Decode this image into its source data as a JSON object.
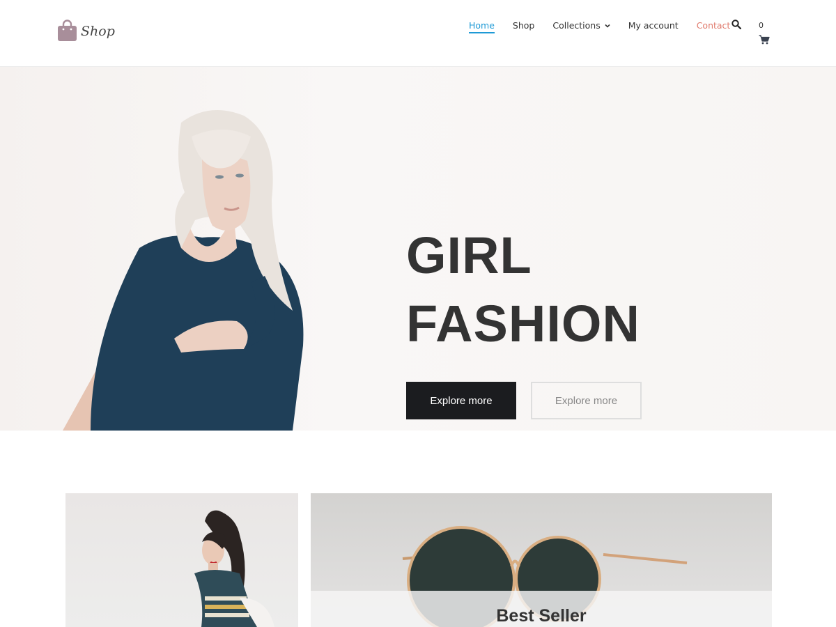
{
  "brand": {
    "name": "Shop",
    "logo_color": "#a88e9a"
  },
  "nav": {
    "items": [
      {
        "label": "Home",
        "active": true
      },
      {
        "label": "Shop"
      },
      {
        "label": "Collections",
        "has_dropdown": true
      },
      {
        "label": "My account"
      },
      {
        "label": "Contact",
        "color": "#e07a6c"
      }
    ],
    "cart_count": "0",
    "accent": "#1e9ad6",
    "icons": [
      "search-icon",
      "cart-icon",
      "chevron-down-icon"
    ]
  },
  "hero": {
    "title_line1": "GIRL",
    "title_line2": "FASHION",
    "primary_button": "Explore more",
    "secondary_button": "Explore more"
  },
  "cards": {
    "right_caption": "Best Seller"
  }
}
